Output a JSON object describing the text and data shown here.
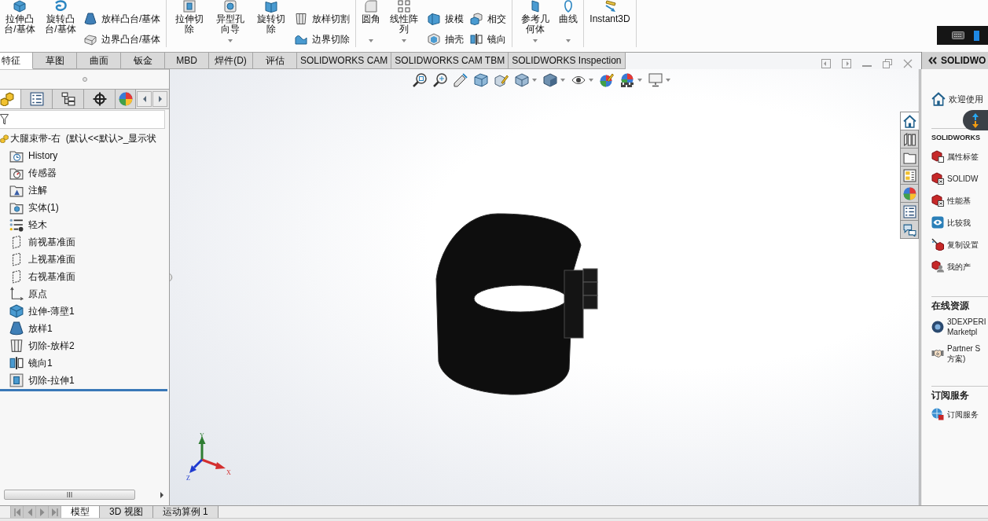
{
  "ribbon": {
    "groups": [
      {
        "items": [
          {
            "kind": "large",
            "label": "拉伸凸台/基体",
            "dropdown": false
          },
          {
            "kind": "large",
            "label": "旋转凸台/基体",
            "dropdown": false
          },
          {
            "kind": "stack",
            "tools": [
              {
                "label": "放样凸台/基体"
              },
              {
                "label": "边界凸台/基体"
              }
            ]
          }
        ]
      },
      {
        "items": [
          {
            "kind": "large",
            "label": "拉伸切除",
            "dropdown": false
          },
          {
            "kind": "large",
            "label": "异型孔向导",
            "dropdown": true
          },
          {
            "kind": "large",
            "label": "旋转切除",
            "dropdown": false
          },
          {
            "kind": "stack",
            "tools": [
              {
                "label": "放样切割"
              },
              {
                "label": "边界切除"
              }
            ]
          }
        ]
      },
      {
        "items": [
          {
            "kind": "large",
            "label": "圆角",
            "dropdown": true
          },
          {
            "kind": "large",
            "label": "线性阵列",
            "dropdown": true
          },
          {
            "kind": "stack",
            "tools": [
              {
                "label": "拔模"
              },
              {
                "label": "抽壳"
              }
            ]
          },
          {
            "kind": "stack",
            "tools": [
              {
                "label": "相交"
              },
              {
                "label": "镜向"
              }
            ]
          }
        ]
      },
      {
        "items": [
          {
            "kind": "large",
            "label": "参考几何体",
            "dropdown": true
          },
          {
            "kind": "large",
            "label": "曲线",
            "dropdown": true
          }
        ]
      },
      {
        "items": [
          {
            "kind": "large",
            "label": "Instant3D",
            "dropdown": false
          }
        ]
      }
    ]
  },
  "tabs": [
    {
      "label": "特征",
      "selected": true
    },
    {
      "label": "草图",
      "selected": false
    },
    {
      "label": "曲面",
      "selected": false
    },
    {
      "label": "钣金",
      "selected": false
    },
    {
      "label": "MBD",
      "selected": false
    },
    {
      "label": "焊件(D)",
      "selected": false
    },
    {
      "label": "评估",
      "selected": false
    },
    {
      "label": "SOLIDWORKS CAM",
      "selected": false
    },
    {
      "label": "SOLIDWORKS CAM TBM",
      "selected": false
    },
    {
      "label": "SOLIDWORKS Inspection",
      "selected": false
    }
  ],
  "feature_manager": {
    "panel_tabs": [
      {
        "selected": true
      },
      {
        "selected": false
      },
      {
        "selected": false
      },
      {
        "selected": false
      },
      {
        "selected": false
      }
    ],
    "tree": {
      "label": "大腿束带-右  (默认<<默认>_显示状",
      "children": [
        {
          "label": "History"
        },
        {
          "label": "传感器"
        },
        {
          "label": "注解"
        },
        {
          "label": "实体(1)"
        },
        {
          "label": "轻木"
        },
        {
          "label": "前视基准面"
        },
        {
          "label": "上视基准面"
        },
        {
          "label": "右视基准面"
        },
        {
          "label": "原点"
        },
        {
          "label": "拉伸-薄壁1"
        },
        {
          "label": "放样1"
        },
        {
          "label": "切除-放样2"
        },
        {
          "label": "镜向1"
        },
        {
          "label": "切除-拉伸1"
        }
      ]
    }
  },
  "viewport": {
    "triad": {
      "x": "X",
      "y": "Y",
      "z": "Z"
    }
  },
  "task_pane": {
    "title": "SOLIDWO",
    "side_tabs": [
      {
        "selected": true
      },
      {
        "selected": false
      },
      {
        "selected": false
      },
      {
        "selected": false
      },
      {
        "selected": false
      },
      {
        "selected": false
      },
      {
        "selected": false
      }
    ],
    "welcome": "欢迎使用",
    "sections": [
      {
        "heading": "SOLIDWORKS",
        "links": [
          {
            "lines": [
              "属性标签"
            ]
          },
          {
            "lines": [
              "SOLIDW"
            ]
          },
          {
            "lines": [
              "性能基"
            ]
          },
          {
            "lines": [
              "比较我"
            ]
          },
          {
            "lines": [
              "复制设置"
            ]
          },
          {
            "lines": [
              "我的产"
            ]
          }
        ]
      },
      {
        "heading": "在线资源",
        "links": [
          {
            "lines": [
              "3DEXPERI",
              "Marketpl"
            ]
          },
          {
            "lines": [
              "Partner S",
              "方案)"
            ]
          }
        ]
      },
      {
        "heading": "订阅服务",
        "links": [
          {
            "lines": [
              "订阅服务"
            ]
          }
        ]
      }
    ]
  },
  "bottom_tabs": {
    "navigation_disabled": true,
    "tabs": [
      {
        "label": "模型",
        "selected": true
      },
      {
        "label": "3D 视图",
        "selected": false
      },
      {
        "label": "运动算例 1",
        "selected": false
      }
    ]
  }
}
